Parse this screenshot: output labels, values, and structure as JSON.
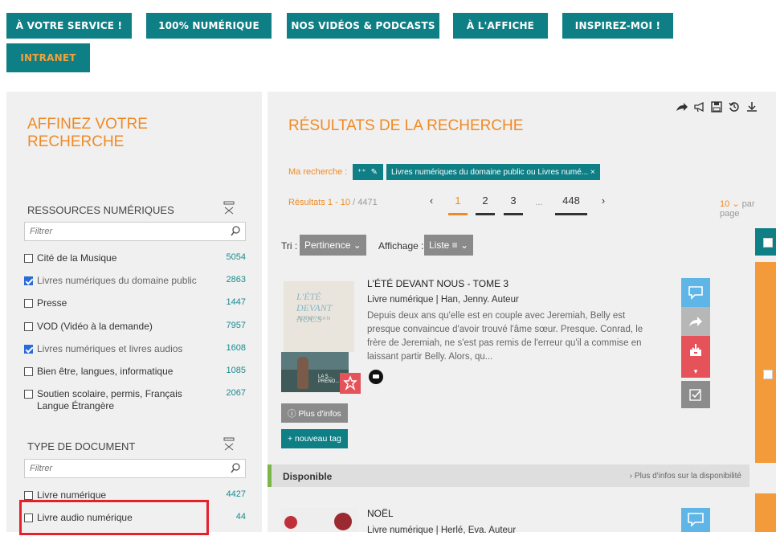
{
  "nav": {
    "items": [
      {
        "label": "À VOTRE SERVICE !"
      },
      {
        "label": "100% NUMÉRIQUE"
      },
      {
        "label": "NOS VIDÉOS & PODCASTS"
      },
      {
        "label": "À L'AFFICHE"
      },
      {
        "label": "INSPIREZ-MOI !"
      },
      {
        "label": "INTRANET"
      }
    ]
  },
  "filters": {
    "title": "AFFINEZ VOTRE RECHERCHE",
    "sections": [
      {
        "title": "RESSOURCES NUMÉRIQUES",
        "placeholder": "Filtrer",
        "items": [
          {
            "label": "Cité de la Musique",
            "count": "5054",
            "checked": false
          },
          {
            "label": "Livres numériques du domaine public",
            "count": "2863",
            "checked": true
          },
          {
            "label": "Presse",
            "count": "1447",
            "checked": false
          },
          {
            "label": "VOD (Vidéo à la demande)",
            "count": "7957",
            "checked": false
          },
          {
            "label": "Livres numériques et livres audios",
            "count": "1608",
            "checked": true
          },
          {
            "label": "Bien être, langues, informatique",
            "count": "1085",
            "checked": false
          },
          {
            "label": "Soutien scolaire, permis, Français Langue Étrangère",
            "count": "2067",
            "checked": false
          }
        ]
      },
      {
        "title": "TYPE DE DOCUMENT",
        "placeholder": "Filtrer",
        "items": [
          {
            "label": "Livre numérique",
            "count": "4427",
            "checked": false
          },
          {
            "label": "Livre audio numérique",
            "count": "44",
            "checked": false
          }
        ]
      }
    ]
  },
  "results": {
    "title": "RÉSULTATS DE LA RECHERCHE",
    "ma_recherche_label": "Ma recherche :",
    "chip_text": "Livres numériques du domaine public ou Livres numé... ×",
    "range_label": "Résultats 1 - 10",
    "range_total": " / 4471",
    "pager": {
      "prev": "‹",
      "pages": [
        "1",
        "2",
        "3"
      ],
      "ellipsis": "...",
      "last": "448",
      "next": "›",
      "active": "1"
    },
    "per_page": "10",
    "per_page_label": "par page",
    "sort_label": "Tri :",
    "sort_value": "Pertinence ⌄",
    "display_label": "Affichage :",
    "display_value": "Liste ≡ ⌄",
    "items": [
      {
        "title": "L'ÉTÉ DEVANT NOUS - TOME 3",
        "subtitle": "Livre numérique | Han, Jenny. Auteur",
        "description": "Depuis deux ans qu'elle est en couple avec Jeremiah, Belly est presque convaincue d'avoir trouvé l'âme sœur. Presque. Conrad, le frère de Jeremiah, ne s'est pas remis de l'erreur qu'il a commise en laissant partir Belly. Alors, qu...",
        "cover_title": "L'ÉTÉ DEVANT NOUS",
        "cover_author": "JENNY HAN",
        "cover2_label": "LA S... PRÉNO...",
        "more_info": "ⓘ Plus d'infos",
        "new_tag": "+ nouveau tag",
        "availability": "Disponible",
        "availability_more": "› Plus d'infos sur la disponibilité"
      },
      {
        "title": "NOËL",
        "subtitle": "Livre numérique | Herlé, Eva. Auteur"
      }
    ]
  },
  "colors": {
    "teal": "#0f7f86",
    "orange": "#f08a24",
    "highlight_red": "#e5202b",
    "blue_action": "#5fb5e5",
    "red_action": "#e5525a",
    "available_green": "#7ab648"
  }
}
